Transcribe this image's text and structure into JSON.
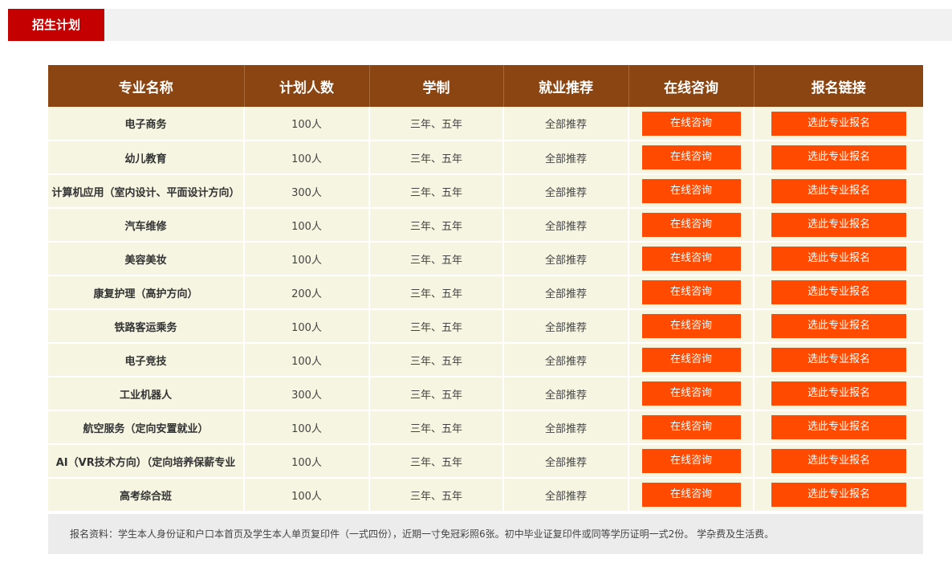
{
  "section": {
    "title": "招生计划"
  },
  "table": {
    "headers": [
      "专业名称",
      "计划人数",
      "学制",
      "就业推荐",
      "在线咨询",
      "报名链接"
    ],
    "consult_label": "在线咨询",
    "apply_label": "选此专业报名",
    "rows": [
      {
        "major": "电子商务",
        "quota": "100人",
        "duration": "三年、五年",
        "employment": "全部推荐"
      },
      {
        "major": "幼儿教育",
        "quota": "100人",
        "duration": "三年、五年",
        "employment": "全部推荐"
      },
      {
        "major": "计算机应用（室内设计、平面设计方向）",
        "quota": "300人",
        "duration": "三年、五年",
        "employment": "全部推荐"
      },
      {
        "major": "汽车维修",
        "quota": "100人",
        "duration": "三年、五年",
        "employment": "全部推荐"
      },
      {
        "major": "美容美妆",
        "quota": "100人",
        "duration": "三年、五年",
        "employment": "全部推荐"
      },
      {
        "major": "康复护理（高护方向）",
        "quota": "200人",
        "duration": "三年、五年",
        "employment": "全部推荐"
      },
      {
        "major": "铁路客运乘务",
        "quota": "100人",
        "duration": "三年、五年",
        "employment": "全部推荐"
      },
      {
        "major": "电子竞技",
        "quota": "100人",
        "duration": "三年、五年",
        "employment": "全部推荐"
      },
      {
        "major": "工业机器人",
        "quota": "300人",
        "duration": "三年、五年",
        "employment": "全部推荐"
      },
      {
        "major": "航空服务（定向安置就业）",
        "quota": "100人",
        "duration": "三年、五年",
        "employment": "全部推荐"
      },
      {
        "major": "AI（VR技术方向）（定向培养保薪专业",
        "quota": "100人",
        "duration": "三年、五年",
        "employment": "全部推荐"
      },
      {
        "major": "高考综合班",
        "quota": "100人",
        "duration": "三年、五年",
        "employment": "全部推荐"
      }
    ]
  },
  "note": "报名资料：学生本人身份证和户口本首页及学生本人单页复印件（一式四份），近期一寸免冠彩照6张。初中毕业证复印件或同等学历证明一式2份。 学杂费及生活费。",
  "colors": {
    "accent_red": "#c40000",
    "header_brown": "#8b4512",
    "button_orange": "#ff4a00",
    "row_bg": "#f5f5e2"
  }
}
